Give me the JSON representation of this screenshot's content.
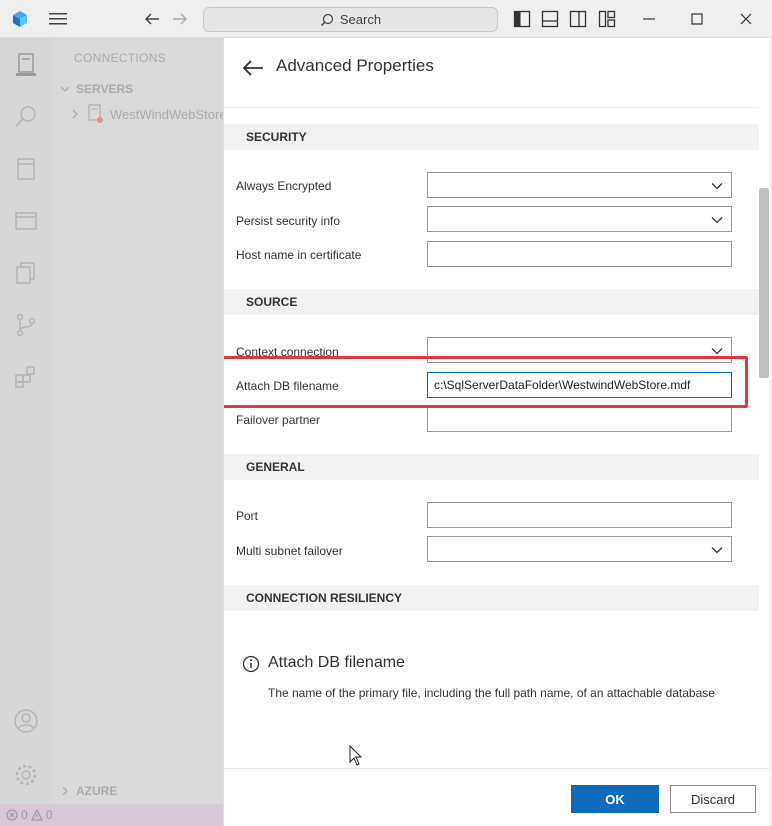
{
  "titlebar": {
    "search_label": "Search"
  },
  "sidebar": {
    "heading": "CONNECTIONS",
    "servers_label": "SERVERS",
    "server_name": "WestWindWebStore",
    "azure_label": "AZURE"
  },
  "statusbar": {
    "errors": "0",
    "warnings": "0"
  },
  "dialog": {
    "title": "Advanced Properties",
    "sections": {
      "security": "SECURITY",
      "source": "SOURCE",
      "general": "GENERAL",
      "resiliency": "CONNECTION RESILIENCY"
    },
    "fields": {
      "always_encrypted": {
        "label": "Always Encrypted",
        "value": ""
      },
      "persist_security_info": {
        "label": "Persist security info",
        "value": ""
      },
      "host_name_in_certificate": {
        "label": "Host name in certificate",
        "value": ""
      },
      "context_connection": {
        "label": "Context connection",
        "value": ""
      },
      "attach_db_filename": {
        "label": "Attach DB filename",
        "value": "c:\\SqlServerDataFolder\\WestwindWebStore.mdf"
      },
      "failover_partner": {
        "label": "Failover partner",
        "value": ""
      },
      "port": {
        "label": "Port",
        "value": ""
      },
      "multi_subnet_failover": {
        "label": "Multi subnet failover",
        "value": ""
      }
    },
    "info": {
      "title": "Attach DB filename",
      "description": "The name of the primary file, including the full path name, of an attachable database"
    },
    "buttons": {
      "ok": "OK",
      "discard": "Discard"
    }
  },
  "colors": {
    "accent": "#0f6cbd",
    "highlight": "#e0383e"
  }
}
